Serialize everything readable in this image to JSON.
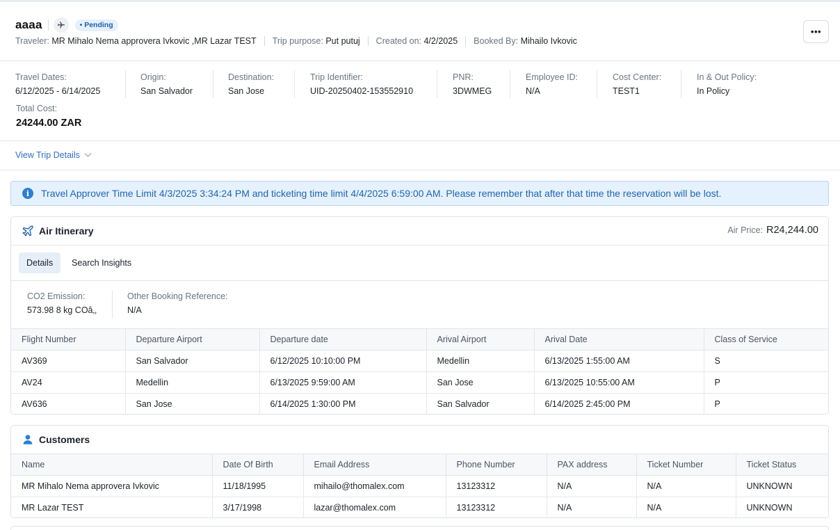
{
  "header": {
    "title": "aaaa",
    "status": "• Pending",
    "traveler_label": "Traveler:",
    "traveler_value": "MR Mihalo Nema approvera Ivkovic ,MR Lazar TEST",
    "purpose_label": "Trip purpose:",
    "purpose_value": "Put putuj",
    "created_label": "Created on:",
    "created_value": "4/2/2025",
    "booked_label": "Booked By:",
    "booked_value": "Mihailo Ivkovic",
    "menu": "•••"
  },
  "info": {
    "travel_dates": {
      "label": "Travel Dates:",
      "value": "6/12/2025 - 6/14/2025"
    },
    "origin": {
      "label": "Origin:",
      "value": "San Salvador"
    },
    "destination": {
      "label": "Destination:",
      "value": "San Jose"
    },
    "trip_identifier": {
      "label": "Trip Identifier:",
      "value": "UID-20250402-153552910"
    },
    "pnr": {
      "label": "PNR:",
      "value": "3DWMEG"
    },
    "employee_id": {
      "label": "Employee ID:",
      "value": "N/A"
    },
    "cost_center": {
      "label": "Cost Center:",
      "value": "TEST1"
    },
    "policy": {
      "label": "In & Out Policy:",
      "value": "In Policy"
    },
    "total_cost": {
      "label": "Total Cost:",
      "value": "24244.00 ZAR"
    }
  },
  "view_trip_details": "View Trip Details",
  "alert": {
    "icon": "info-icon",
    "text": "Travel Approver Time Limit 4/3/2025 3:34:24 PM and ticketing time limit 4/4/2025 6:59:00 AM. Please remember that after that time the reservation will be lost."
  },
  "air": {
    "title": "Air Itinerary",
    "icon": "plane-icon",
    "price_label": "Air Price:",
    "price_value": "R24,244.00",
    "tabs": [
      "Details",
      "Search Insights"
    ],
    "co2_label": "CO2 Emission:",
    "co2_value": "573.98 8 kg COâ‚‚",
    "other_ref_label": "Other Booking Reference:",
    "other_ref_value": "N/A",
    "columns": [
      "Flight Number",
      "Departure Airport",
      "Departure date",
      "Arival Airport",
      "Arival Date",
      "Class of Service"
    ],
    "rows": [
      [
        "AV369",
        "San Salvador",
        "6/12/2025 10:10:00 PM",
        "Medellin",
        "6/13/2025 1:55:00 AM",
        "S"
      ],
      [
        "AV24",
        "Medellin",
        "6/13/2025 9:59:00 AM",
        "San Jose",
        "6/13/2025 10:55:00 AM",
        "P"
      ],
      [
        "AV636",
        "San Jose",
        "6/14/2025 1:30:00 PM",
        "San Salvador",
        "6/14/2025 2:45:00 PM",
        "P"
      ]
    ]
  },
  "customers": {
    "title": "Customers",
    "icon": "user-icon",
    "columns": [
      "Name",
      "Date Of Birth",
      "Email Address",
      "Phone Number",
      "PAX address",
      "Ticket Number",
      "Ticket Status"
    ],
    "rows": [
      [
        "MR Mihalo Nema approvera Ivkovic",
        "11/18/1995",
        "mihailo@thomalex.com",
        "13123312",
        "N/A",
        "N/A",
        "UNKNOWN"
      ],
      [
        "MR Lazar TEST",
        "3/17/1998",
        "lazar@thomalex.com",
        "13123312",
        "N/A",
        "N/A",
        "UNKNOWN"
      ]
    ]
  },
  "colors": {
    "accent": "#2f6ec4",
    "alert_bg": "#e5f1fc",
    "badge_bg": "#e6f0fb"
  }
}
